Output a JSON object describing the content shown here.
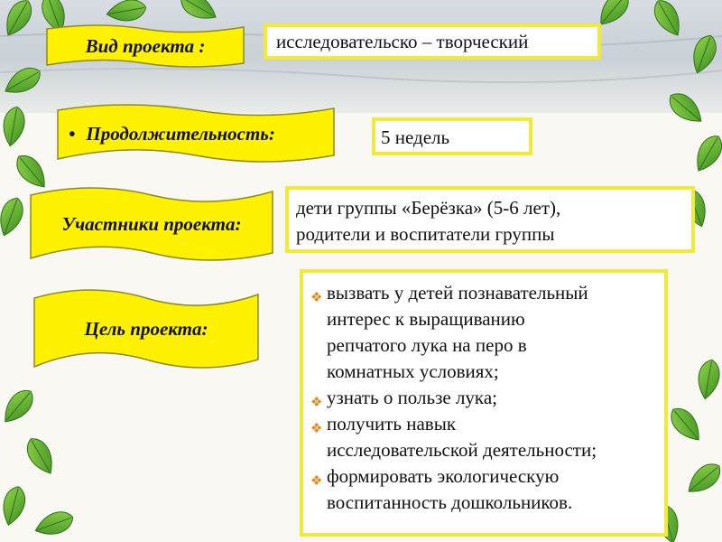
{
  "colors": {
    "banner_fill": "#fff200",
    "banner_stroke": "#8a8a2a",
    "box_border": "#f2ea3a",
    "bullet": "#e28a1e",
    "leaf": "#5fae2e"
  },
  "rows": {
    "project_type": {
      "label": "Вид проекта :",
      "value": "исследовательско – творческий"
    },
    "duration": {
      "bullet": "•",
      "label": "Продолжительность:",
      "value": "5 недель"
    },
    "participants": {
      "label": "Участники проекта:",
      "value_line1": "дети группы «Берёзка» (5-6 лет),",
      "value_line2": "родители и воспитатели группы"
    },
    "goal": {
      "label": "Цель проекта:",
      "bullet_icon": "diamond-bullet-icon",
      "items": [
        {
          "line1": "вызвать у детей познавательный",
          "line2": "интерес к выращиванию",
          "line3": "репчатого лука на перо в",
          "line4": "комнатных условиях;"
        },
        {
          "line1": "узнать о пользе лука;"
        },
        {
          "line1": "получить навык",
          "line2": "исследовательской деятельности;"
        },
        {
          "line1": "формировать экологическую",
          "line2": "воспитанность дошкольников."
        }
      ]
    }
  }
}
